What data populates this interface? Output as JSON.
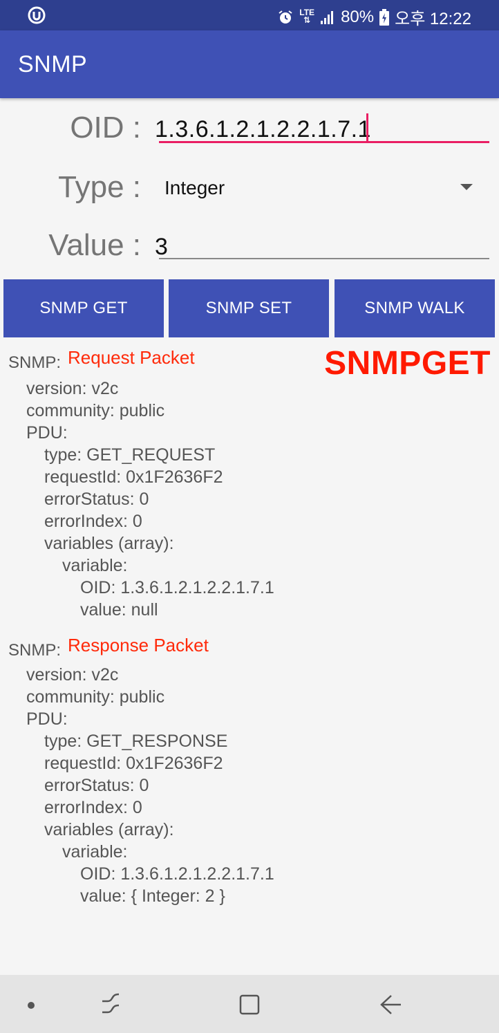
{
  "status_bar": {
    "network": "LTE",
    "battery": "80%",
    "time": "오후 12:22",
    "icons": [
      "app-notification-icon",
      "alarm-icon",
      "lte-signal-icon",
      "signal-bars-icon",
      "battery-charging-icon"
    ]
  },
  "app_bar": {
    "title": "SNMP"
  },
  "form": {
    "oid_label": "OID :",
    "oid_value": "1.3.6.1.2.1.2.2.1.7.1",
    "type_label": "Type :",
    "type_value": "Integer",
    "value_label": "Value :",
    "value_value": "3"
  },
  "buttons": {
    "get": "SNMP GET",
    "set": "SNMP SET",
    "walk": "SNMP WALK"
  },
  "annotation": "SNMPGET",
  "request": {
    "prefix": "SNMP:",
    "highlight": "Request Packet",
    "lines": [
      "version: v2c",
      "community: public",
      "PDU:",
      "type: GET_REQUEST",
      "requestId: 0x1F2636F2",
      "errorStatus: 0",
      "errorIndex: 0",
      "variables (array):",
      "variable:",
      "OID: 1.3.6.1.2.1.2.2.1.7.1",
      "value: null"
    ]
  },
  "response": {
    "prefix": "SNMP:",
    "highlight": "Response Packet",
    "lines": [
      "version: v2c",
      "community: public",
      "PDU:",
      "type: GET_RESPONSE",
      "requestId: 0x1F2636F2",
      "errorStatus: 0",
      "errorIndex: 0",
      "variables (array):",
      "variable:",
      "OID: 1.3.6.1.2.1.2.2.1.7.1",
      "value: { Integer: 2 }"
    ]
  },
  "colors": {
    "status_bar": "#2e3f8f",
    "app_bar": "#3f51b5",
    "accent": "#e91e63",
    "highlight": "#ff2a0a"
  }
}
